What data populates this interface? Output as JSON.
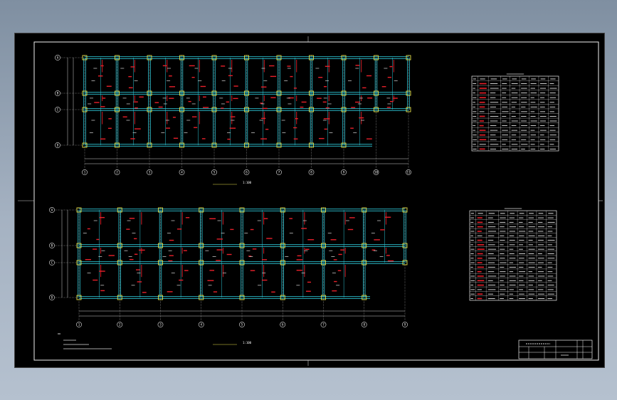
{
  "drawing": {
    "plan_1": {
      "title": "",
      "scale": "1:100",
      "axis_numbers": [
        "1",
        "2",
        "3",
        "4",
        "5",
        "6",
        "7",
        "8",
        "9",
        "10",
        "11"
      ],
      "axis_letters": [
        "A",
        "B",
        "C",
        "D"
      ]
    },
    "plan_2": {
      "title": "",
      "scale": "1:100",
      "axis_numbers": [
        "1",
        "2",
        "3",
        "4",
        "5",
        "6",
        "7",
        "8",
        "9"
      ],
      "axis_letters": [
        "A",
        "B",
        "C",
        "D"
      ]
    },
    "table_1": {
      "title": "",
      "rows": 16,
      "cols": 9
    },
    "table_2": {
      "title": "",
      "rows": 20,
      "cols": 9
    },
    "title_block": {
      "project": "",
      "drawing_no": "",
      "sheet": ""
    },
    "colors": {
      "background": "#000000",
      "beam": "#2ec8d8",
      "column": "#e8e04a",
      "rebar": "#e8202a",
      "frame": "#ffffff"
    }
  }
}
